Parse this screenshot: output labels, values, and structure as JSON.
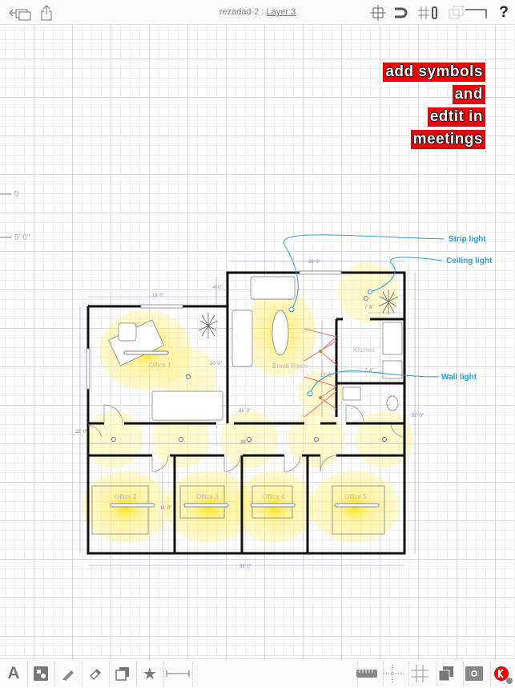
{
  "topbar": {
    "doc_name": "rezadad-2 : ",
    "layer": "Layer 3",
    "icons": [
      "back-icon",
      "share-icon",
      "snap-target-icon",
      "magnet-icon",
      "grid-lock-icon",
      "layers-icon",
      "help-icon"
    ]
  },
  "overlay_text": [
    "add symbols",
    "and",
    "edtit in",
    "meetings"
  ],
  "ruler": {
    "mark0": "0",
    "mark1": "5' 0\""
  },
  "annotations": {
    "strip": "Strip light",
    "ceiling": "Ceiling light",
    "wall": "Wall light"
  },
  "rooms": {
    "office1": "Office 1",
    "break": "Break Room",
    "kitchen": "Kitchen",
    "office2": "Office 2",
    "office3": "Office 3",
    "office4": "Office 4",
    "office5": "Office 5"
  },
  "dimensions": {
    "top": "20' 0\"",
    "office1_w": "16' 0\"",
    "small": "4' 0\"",
    "office1_h": "10' 0\"",
    "kitchen_w": "7' 6\"",
    "kitchen_w2": "7' 6\"",
    "hall": "36' 0\"",
    "hall2": "36' 0\"",
    "bottom": "36' 0\"",
    "office_h": "11' 0\"",
    "left": "28' 0\"",
    "right": "32' 0\"",
    "break_h": "12' 0\""
  },
  "colors": {
    "accent_red": "#e8000b",
    "annotation_blue": "#2a9fd8",
    "light_yellow": "#ffe800",
    "wall": "#111111",
    "wall_light_arrow": "#f26a6a"
  },
  "bottombar": {
    "text_tool": "A",
    "icons": [
      "text-icon",
      "shape-icon",
      "pencil-icon",
      "eraser-icon",
      "image-icon",
      "star-icon",
      "dimension-icon",
      "ruler-icon",
      "crosshair-icon",
      "grid-icon",
      "layers-icon",
      "settings-icon",
      "app-logo-icon"
    ]
  }
}
